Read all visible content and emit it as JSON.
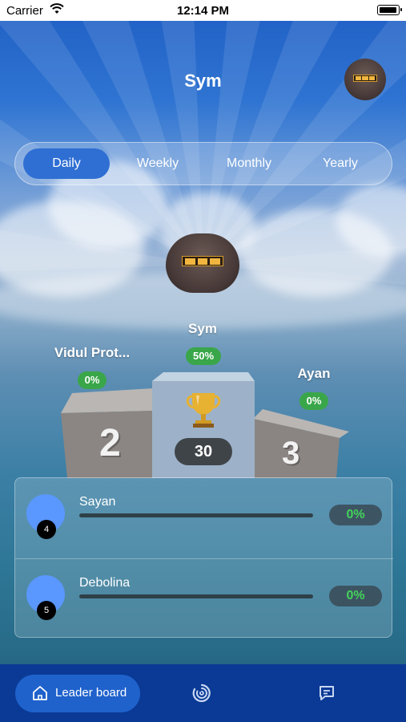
{
  "status_bar": {
    "carrier": "Carrier",
    "time": "12:14 PM"
  },
  "header": {
    "title": "Sym"
  },
  "period_tabs": [
    {
      "label": "Daily",
      "active": true
    },
    {
      "label": "Weekly",
      "active": false
    },
    {
      "label": "Monthly",
      "active": false
    },
    {
      "label": "Yearly",
      "active": false
    }
  ],
  "podium": {
    "first": {
      "name": "Sym",
      "percent": "50%",
      "score": "30",
      "rank": "1"
    },
    "second": {
      "name": "Vidul Prot...",
      "percent": "0%",
      "rank": "2"
    },
    "third": {
      "name": "Ayan",
      "percent": "0%",
      "rank": "3"
    }
  },
  "leaderboard": [
    {
      "rank": "4",
      "name": "Sayan",
      "percent": "0%",
      "progress": 0
    },
    {
      "rank": "5",
      "name": "Debolina",
      "percent": "0%",
      "progress": 0
    }
  ],
  "tab_bar": {
    "leader_label": "Leader board",
    "icons": [
      "home-icon",
      "activity-ring-icon",
      "chat-icon"
    ]
  },
  "colors": {
    "accent": "#2f6fd3",
    "tabbar": "#0a3a95",
    "pill_green": "#3aa64a",
    "percent_green": "#43d35a",
    "avatar_blue": "#5a97ff"
  }
}
